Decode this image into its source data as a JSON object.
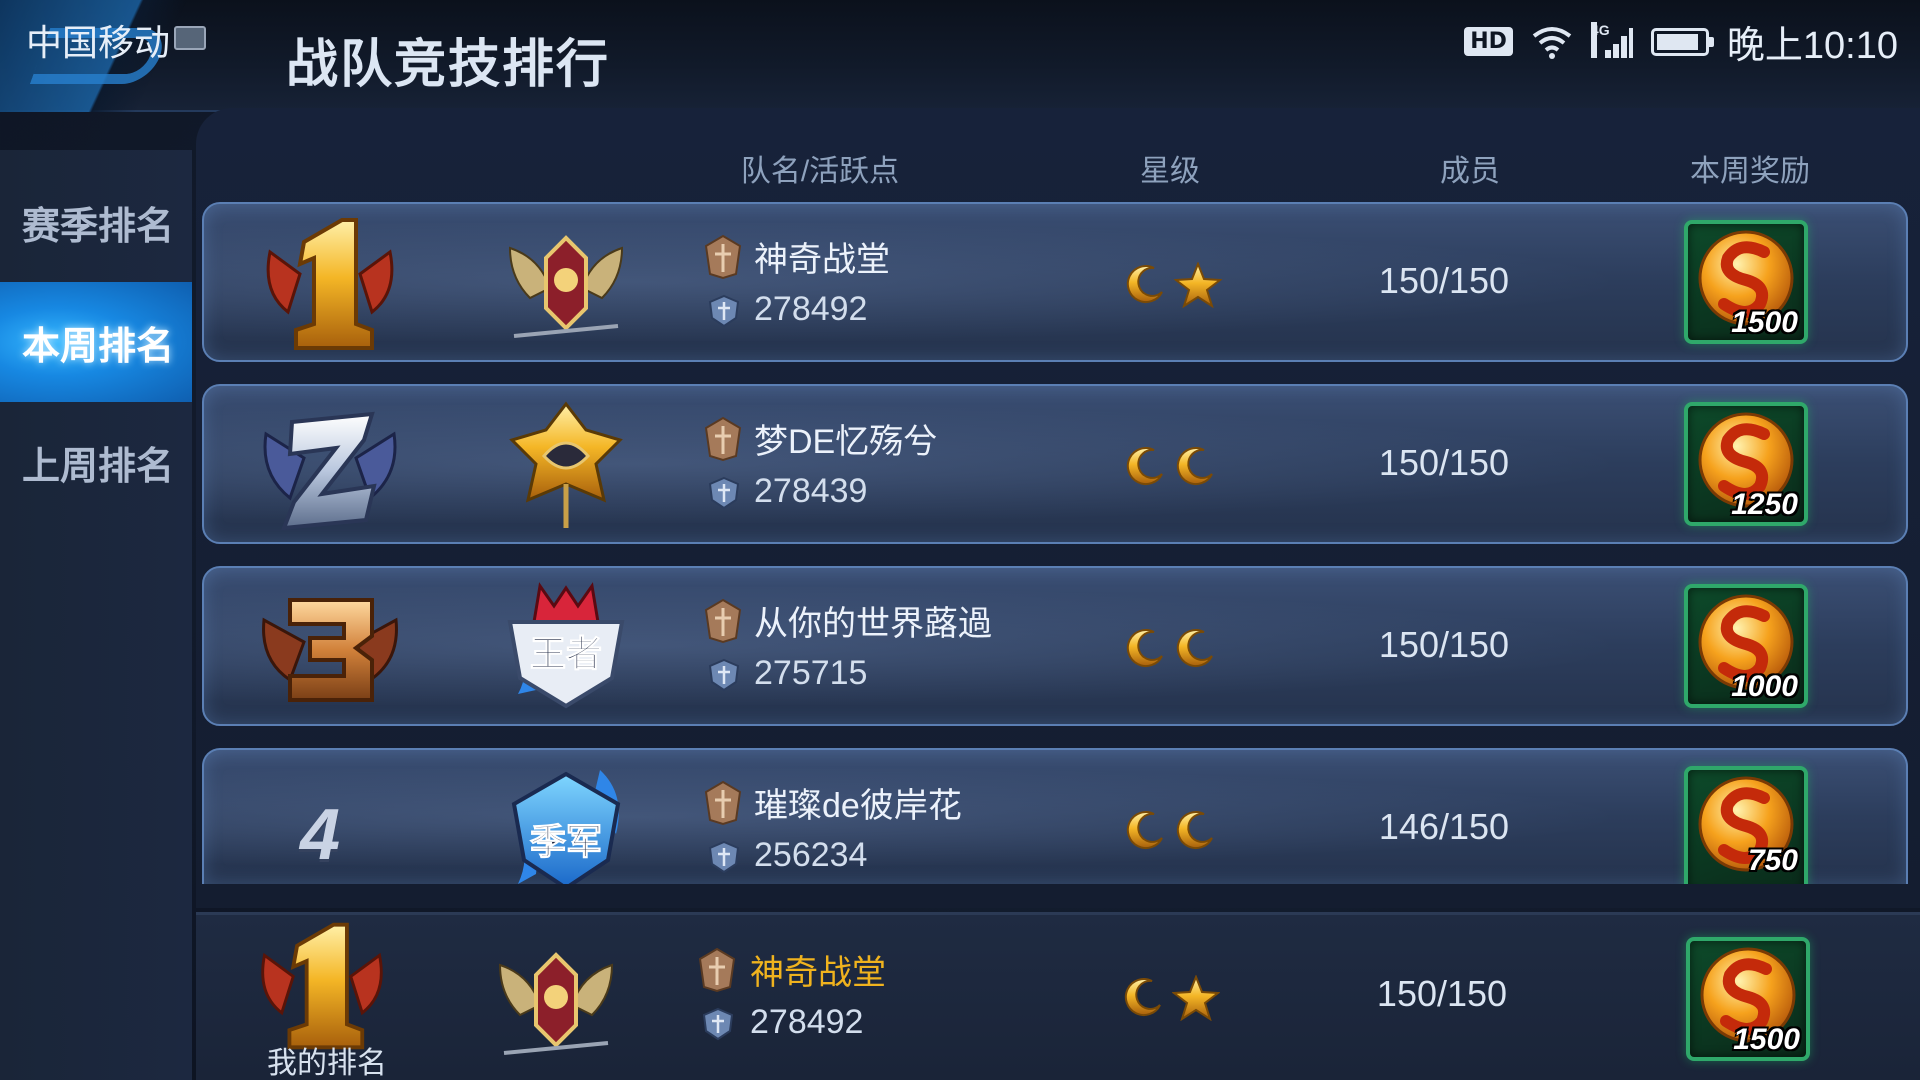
{
  "status_bar": {
    "carrier": "中国移动",
    "hd": "HD",
    "network": "4G",
    "battery_level": 0.9,
    "time": "晚上10:10"
  },
  "page_title": "战队竞技排行",
  "sidebar": {
    "tabs": [
      {
        "label": "赛季排名",
        "active": false
      },
      {
        "label": "本周排名",
        "active": true
      },
      {
        "label": "上周排名",
        "active": false
      }
    ]
  },
  "columns": {
    "name": "队名/活跃点",
    "stars": "星级",
    "members": "成员",
    "reward": "本周奖励"
  },
  "rows": [
    {
      "rank": "1",
      "team_name": "神奇战堂",
      "points": "278492",
      "stars": [
        "moon",
        "star"
      ],
      "members": "150/150",
      "reward": "1500",
      "emblem": "eagle-emblem"
    },
    {
      "rank": "2",
      "team_name": "梦DE忆殇兮",
      "points": "278439",
      "stars": [
        "moon",
        "moon"
      ],
      "members": "150/150",
      "reward": "1250",
      "emblem": "dragon-emblem"
    },
    {
      "rank": "3",
      "team_name": "从你的世界蕗過",
      "points": "275715",
      "stars": [
        "moon",
        "moon"
      ],
      "members": "150/150",
      "reward": "1000",
      "emblem": "king-emblem"
    },
    {
      "rank": "4",
      "team_name": "璀璨de彼岸花",
      "points": "256234",
      "stars": [
        "moon",
        "moon"
      ],
      "members": "146/150",
      "reward": "750",
      "emblem": "champion-emblem"
    }
  ],
  "my_rank": {
    "label": "我的排名",
    "rank": "1",
    "team_name": "神奇战堂",
    "points": "278492",
    "stars": [
      "moon",
      "star"
    ],
    "members": "150/150",
    "reward": "1500"
  },
  "emblem_text": {
    "king": "王者",
    "champion": "季军"
  },
  "colors": {
    "accent_blue": "#1788e2",
    "my_team_name": "#f0b31e",
    "reward_border": "#2fa86a"
  }
}
